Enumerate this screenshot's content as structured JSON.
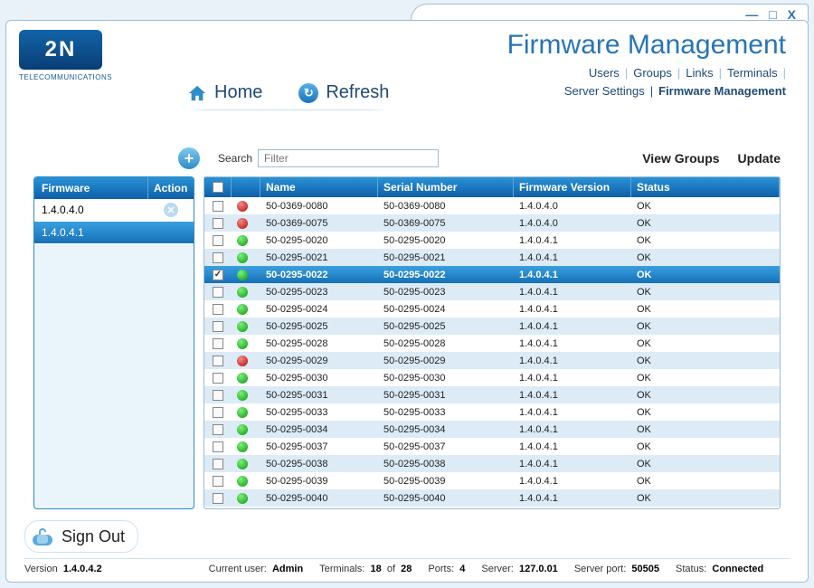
{
  "window": {
    "minimize": "—",
    "maximize": "□",
    "close": "X"
  },
  "brand": {
    "logo_text": "2N",
    "logo_sub": "TELECOMMUNICATIONS"
  },
  "page_title": "Firmware Management",
  "nav_top": [
    "Users",
    "Groups",
    "Links",
    "Terminals"
  ],
  "nav_bottom": [
    "Server Settings",
    "Firmware Management"
  ],
  "nav_current": "Firmware Management",
  "tabs": {
    "home": "Home",
    "refresh": "Refresh"
  },
  "toolbar": {
    "add_tooltip": "+",
    "search_label": "Search",
    "search_placeholder": "Filter",
    "view_groups": "View Groups",
    "update": "Update"
  },
  "sidebar": {
    "head_firmware": "Firmware",
    "head_action": "Action",
    "rows": [
      {
        "version": "1.4.0.4.0",
        "selected": false,
        "deletable": true
      },
      {
        "version": "1.4.0.4.1",
        "selected": true,
        "deletable": false
      }
    ]
  },
  "grid": {
    "head": {
      "checkbox": "",
      "dot": "",
      "name": "Name",
      "serial": "Serial Number",
      "fw": "Firmware Version",
      "status": "Status"
    },
    "rows": [
      {
        "checked": false,
        "color": "red",
        "name": "50-0369-0080",
        "serial": "50-0369-0080",
        "fw": "1.4.0.4.0",
        "status": "OK",
        "selected": false
      },
      {
        "checked": false,
        "color": "red",
        "name": "50-0369-0075",
        "serial": "50-0369-0075",
        "fw": "1.4.0.4.0",
        "status": "OK",
        "selected": false
      },
      {
        "checked": false,
        "color": "green",
        "name": "50-0295-0020",
        "serial": "50-0295-0020",
        "fw": "1.4.0.4.1",
        "status": "OK",
        "selected": false
      },
      {
        "checked": false,
        "color": "green",
        "name": "50-0295-0021",
        "serial": "50-0295-0021",
        "fw": "1.4.0.4.1",
        "status": "OK",
        "selected": false
      },
      {
        "checked": true,
        "color": "green",
        "name": "50-0295-0022",
        "serial": "50-0295-0022",
        "fw": "1.4.0.4.1",
        "status": "OK",
        "selected": true
      },
      {
        "checked": false,
        "color": "green",
        "name": "50-0295-0023",
        "serial": "50-0295-0023",
        "fw": "1.4.0.4.1",
        "status": "OK",
        "selected": false
      },
      {
        "checked": false,
        "color": "green",
        "name": "50-0295-0024",
        "serial": "50-0295-0024",
        "fw": "1.4.0.4.1",
        "status": "OK",
        "selected": false
      },
      {
        "checked": false,
        "color": "green",
        "name": "50-0295-0025",
        "serial": "50-0295-0025",
        "fw": "1.4.0.4.1",
        "status": "OK",
        "selected": false
      },
      {
        "checked": false,
        "color": "green",
        "name": "50-0295-0028",
        "serial": "50-0295-0028",
        "fw": "1.4.0.4.1",
        "status": "OK",
        "selected": false
      },
      {
        "checked": false,
        "color": "red",
        "name": "50-0295-0029",
        "serial": "50-0295-0029",
        "fw": "1.4.0.4.1",
        "status": "OK",
        "selected": false
      },
      {
        "checked": false,
        "color": "green",
        "name": "50-0295-0030",
        "serial": "50-0295-0030",
        "fw": "1.4.0.4.1",
        "status": "OK",
        "selected": false
      },
      {
        "checked": false,
        "color": "green",
        "name": "50-0295-0031",
        "serial": "50-0295-0031",
        "fw": "1.4.0.4.1",
        "status": "OK",
        "selected": false
      },
      {
        "checked": false,
        "color": "green",
        "name": "50-0295-0033",
        "serial": "50-0295-0033",
        "fw": "1.4.0.4.1",
        "status": "OK",
        "selected": false
      },
      {
        "checked": false,
        "color": "green",
        "name": "50-0295-0034",
        "serial": "50-0295-0034",
        "fw": "1.4.0.4.1",
        "status": "OK",
        "selected": false
      },
      {
        "checked": false,
        "color": "green",
        "name": "50-0295-0037",
        "serial": "50-0295-0037",
        "fw": "1.4.0.4.1",
        "status": "OK",
        "selected": false
      },
      {
        "checked": false,
        "color": "green",
        "name": "50-0295-0038",
        "serial": "50-0295-0038",
        "fw": "1.4.0.4.1",
        "status": "OK",
        "selected": false
      },
      {
        "checked": false,
        "color": "green",
        "name": "50-0295-0039",
        "serial": "50-0295-0039",
        "fw": "1.4.0.4.1",
        "status": "OK",
        "selected": false
      },
      {
        "checked": false,
        "color": "green",
        "name": "50-0295-0040",
        "serial": "50-0295-0040",
        "fw": "1.4.0.4.1",
        "status": "OK",
        "selected": false
      }
    ]
  },
  "signout_label": "Sign Out",
  "status": {
    "version_label": "Version",
    "version": "1.4.0.4.2",
    "user_label": "Current user:",
    "user": "Admin",
    "terminals_label": "Terminals:",
    "terminals_cur": "18",
    "terminals_of": "of",
    "terminals_total": "28",
    "ports_label": "Ports:",
    "ports": "4",
    "server_label": "Server:",
    "server": "127.0.01",
    "server_port_label": "Server port:",
    "server_port": "50505",
    "status_label": "Status:",
    "status": "Connected"
  }
}
